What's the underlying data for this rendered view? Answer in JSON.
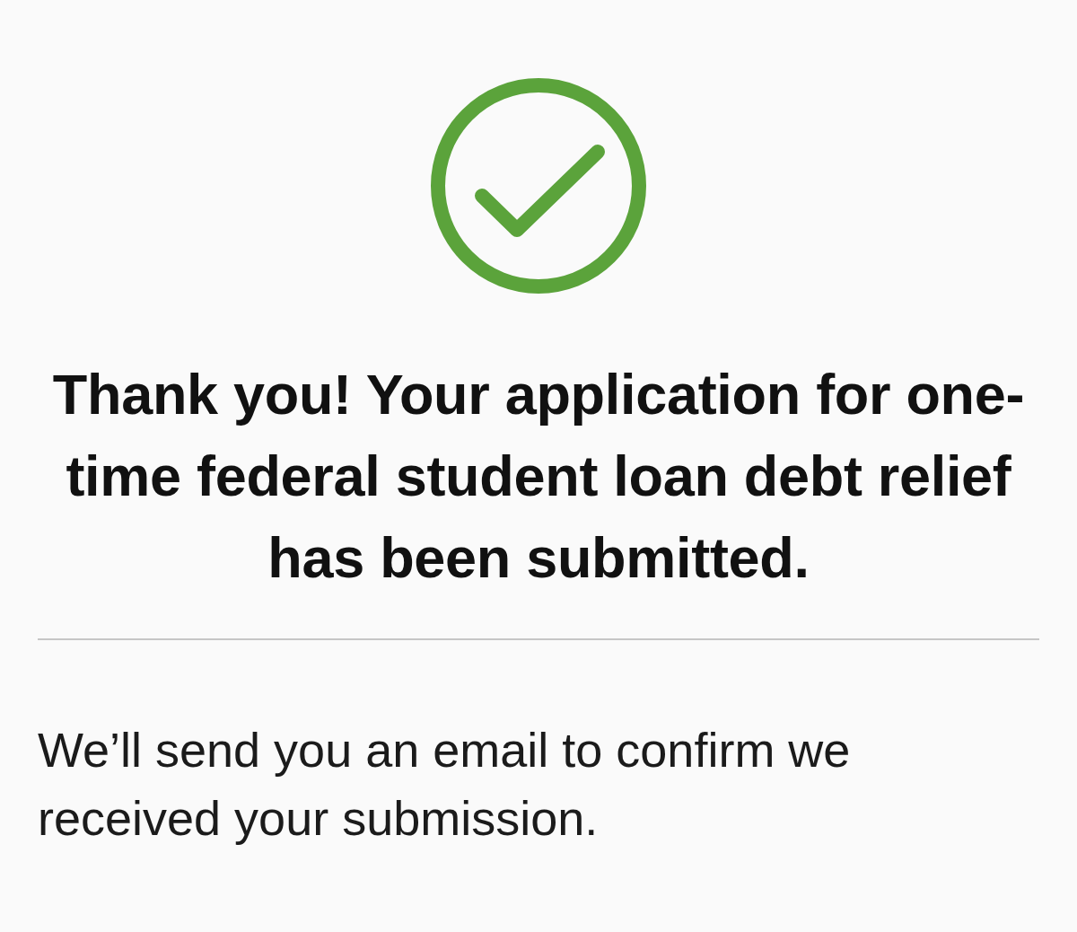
{
  "heading": "Thank you! Your application for one-time federal student loan debt relief has been submitted.",
  "message": "We’ll send you an email to confirm we received your submission."
}
